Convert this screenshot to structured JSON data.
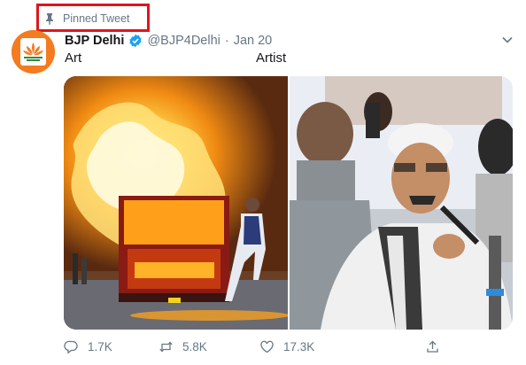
{
  "pinned": {
    "label": "Pinned Tweet",
    "icon": "pin-icon"
  },
  "tweet": {
    "display_name": "BJP Delhi",
    "handle": "@BJP4Delhi",
    "separator": "·",
    "date": "Jan 20",
    "text_left": "Art",
    "text_right": "Artist"
  },
  "actions": {
    "reply_count": "1.7K",
    "retweet_count": "5.8K",
    "like_count": "17.3K"
  },
  "colors": {
    "accent": "#1da1f2",
    "muted": "#657786",
    "highlight_box": "#e0151b",
    "avatar_bg": "#f47b20"
  }
}
